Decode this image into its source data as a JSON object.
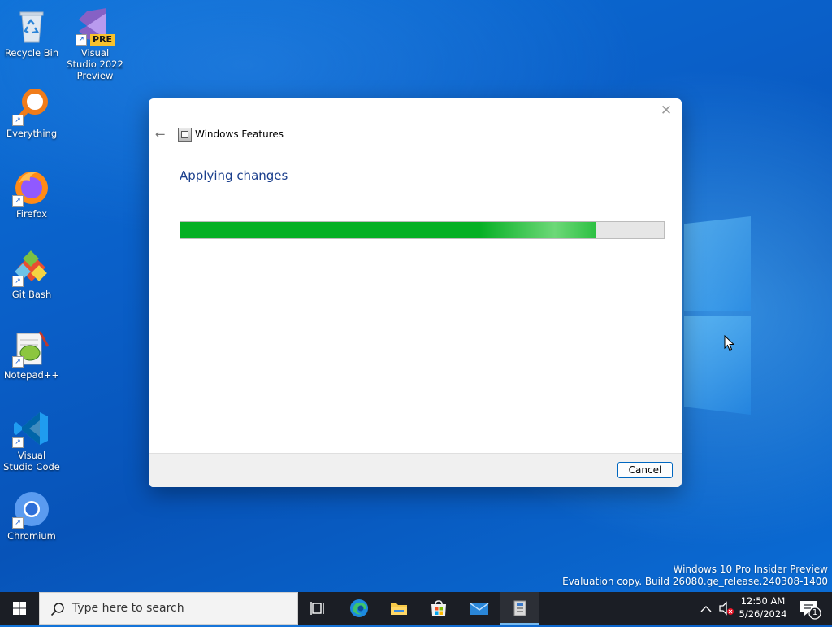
{
  "desktop": {
    "icons": [
      {
        "label": "Recycle Bin",
        "icon": "recycle-bin-icon"
      },
      {
        "label": "Visual Studio 2022 Preview",
        "badge": "PRE",
        "icon": "visual-studio-icon"
      },
      {
        "label": "Everything",
        "icon": "everything-search-icon"
      },
      {
        "label": "Firefox",
        "icon": "firefox-icon"
      },
      {
        "label": "Git Bash",
        "icon": "git-bash-icon"
      },
      {
        "label": "Notepad++",
        "icon": "notepad-plus-plus-icon"
      },
      {
        "label": "Visual Studio Code",
        "icon": "vscode-icon"
      },
      {
        "label": "Chromium",
        "icon": "chromium-icon"
      }
    ],
    "watermark": {
      "line1": "Windows 10 Pro Insider Preview",
      "line2": "Evaluation copy. Build 26080.ge_release.240308-1400"
    }
  },
  "dialog": {
    "title": "Windows Features",
    "heading": "Applying changes",
    "progress_fraction": 0.86,
    "cancel_label": "Cancel",
    "close_glyph": "✕",
    "back_glyph": "←"
  },
  "taskbar": {
    "search_placeholder": "Type here to search",
    "pinned": [
      "task-view-icon",
      "edge-icon",
      "file-explorer-icon",
      "microsoft-store-icon",
      "mail-icon",
      "windows-features-icon"
    ],
    "tray": {
      "time": "12:50 AM",
      "date": "5/26/2024",
      "notification_count": "1"
    }
  },
  "colors": {
    "accent": "#0067c0",
    "progress": "#06b025",
    "heading": "#1a3e8c",
    "taskbar": "#1b1e25"
  }
}
